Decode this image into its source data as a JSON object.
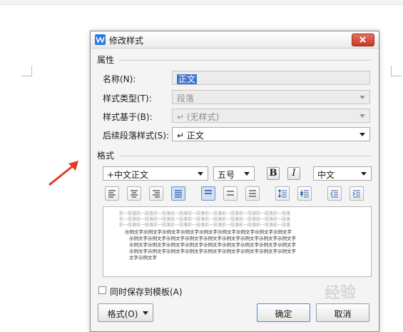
{
  "dialog": {
    "title": "修改样式",
    "properties_label": "属性",
    "name_label": "名称(N):",
    "name_value": "正文",
    "style_type_label": "样式类型(T):",
    "style_type_value": "段落",
    "based_on_label": "样式基于(B):",
    "based_on_value": "↵ (无样式)",
    "next_style_label": "后续段落样式(S):",
    "next_style_value": "↵ 正文",
    "format_label": "格式",
    "font_value": "+中文正文",
    "size_value": "五号",
    "bold_label": "B",
    "italic_label": "I",
    "script_value": "中文",
    "preview_prev_text": "前一段落前一段落前一段落前一段落前一段落前一段落前一段落前一段落前一段落前一段落",
    "preview_sample_text": "示例文字示例文字示例文字示例文字示例文字示例文字示例文字示例文字示例文字",
    "preview_sample_short": "文字示例文字",
    "save_to_template_label": "同时保存到模板(A)",
    "format_button_label": "格式(O)",
    "ok_label": "确定",
    "cancel_label": "取消"
  },
  "watermark": "经验"
}
